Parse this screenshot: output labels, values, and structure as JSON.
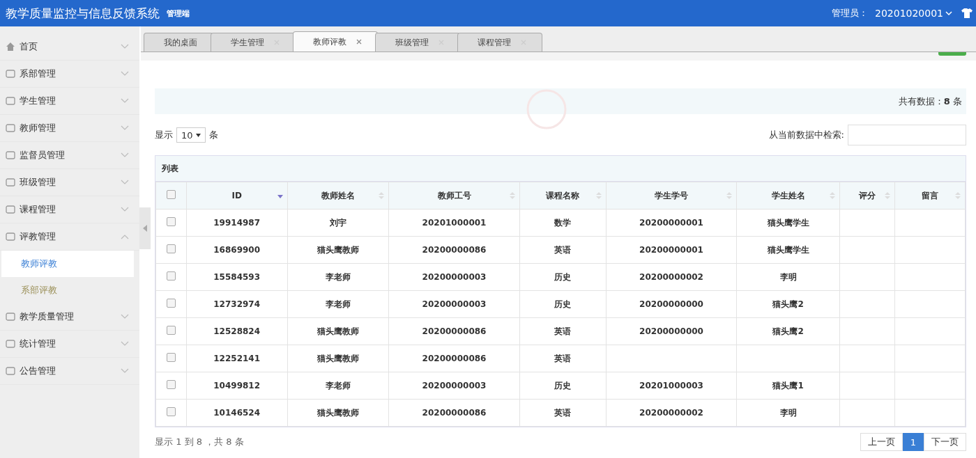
{
  "header": {
    "title": "教学质量监控与信息反馈系统",
    "subtitle": "管理端",
    "user_label": "管理员：",
    "user_id": "20201020001"
  },
  "sidebar": {
    "items": [
      {
        "label": "首页",
        "expanded": false
      },
      {
        "label": "系部管理",
        "expanded": false
      },
      {
        "label": "学生管理",
        "expanded": false
      },
      {
        "label": "教师管理",
        "expanded": false
      },
      {
        "label": "监督员管理",
        "expanded": false
      },
      {
        "label": "班级管理",
        "expanded": false
      },
      {
        "label": "课程管理",
        "expanded": false
      },
      {
        "label": "评教管理",
        "expanded": true,
        "children": [
          {
            "label": "教师评教",
            "selected": true
          },
          {
            "label": "系部评教",
            "selected": false
          }
        ]
      },
      {
        "label": "教学质量管理",
        "expanded": false
      },
      {
        "label": "统计管理",
        "expanded": false
      },
      {
        "label": "公告管理",
        "expanded": false
      }
    ]
  },
  "tabs": [
    {
      "label": "我的桌面",
      "selected": false,
      "closable": false
    },
    {
      "label": "学生管理",
      "selected": false,
      "closable": true
    },
    {
      "label": "教师评教",
      "selected": true,
      "closable": true
    },
    {
      "label": "班级管理",
      "selected": false,
      "closable": true
    },
    {
      "label": "课程管理",
      "selected": false,
      "closable": true
    }
  ],
  "summary": "共有数据：**8** 条",
  "page_size": {
    "prefix": "显示",
    "value": "10",
    "suffix": "条"
  },
  "search": {
    "label": "从当前数据中检索:"
  },
  "table": {
    "title": "列表",
    "select_all_checked": false,
    "columns": [
      {
        "label": "ID",
        "sorted": true
      },
      {
        "label": "教师姓名",
        "sorted": false
      },
      {
        "label": "教师工号",
        "sorted": false
      },
      {
        "label": "课程名称",
        "sorted": false
      },
      {
        "label": "学生学号",
        "sorted": false
      },
      {
        "label": "学生姓名",
        "sorted": false
      },
      {
        "label": "评分",
        "sorted": false
      },
      {
        "label": "留言",
        "sorted": false
      }
    ],
    "rows": [
      {
        "checked": false,
        "cells": [
          "19914987",
          "刘宇",
          "20201000001",
          "数学",
          "20200000001",
          "猫头鹰学生",
          "",
          ""
        ]
      },
      {
        "checked": false,
        "cells": [
          "16869900",
          "猫头鹰教师",
          "20200000086",
          "英语",
          "20200000001",
          "猫头鹰学生",
          "",
          ""
        ]
      },
      {
        "checked": false,
        "cells": [
          "15584593",
          "李老师",
          "20200000003",
          "历史",
          "20200000002",
          "李明",
          "",
          ""
        ]
      },
      {
        "checked": false,
        "cells": [
          "12732974",
          "李老师",
          "20200000003",
          "历史",
          "20200000000",
          "猫头鹰2",
          "",
          ""
        ]
      },
      {
        "checked": false,
        "cells": [
          "12528824",
          "猫头鹰教师",
          "20200000086",
          "英语",
          "20200000000",
          "猫头鹰2",
          "",
          ""
        ]
      },
      {
        "checked": false,
        "cells": [
          "12252141",
          "猫头鹰教师",
          "20200000086",
          "英语",
          "",
          "",
          "",
          ""
        ]
      },
      {
        "checked": false,
        "cells": [
          "10499812",
          "李老师",
          "20200000003",
          "历史",
          "20201000003",
          "猫头鹰1",
          "",
          ""
        ]
      },
      {
        "checked": false,
        "cells": [
          "10146524",
          "猫头鹰教师",
          "20200000086",
          "英语",
          "20200000002",
          "李明",
          "",
          ""
        ]
      }
    ]
  },
  "footer": {
    "info": "显示 1 到 8 ，共 8 条",
    "pagination": [
      {
        "label": "上一页",
        "selected": false
      },
      {
        "label": "1",
        "selected": true
      },
      {
        "label": "下一页",
        "selected": false
      }
    ]
  }
}
